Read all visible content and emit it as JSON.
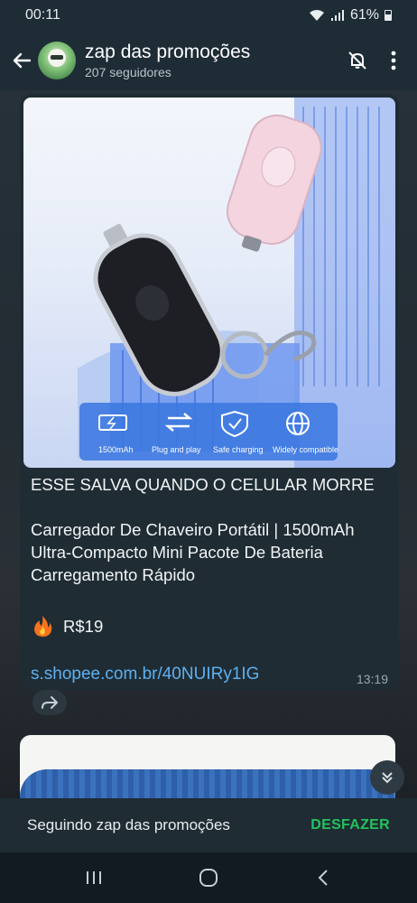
{
  "status_bar": {
    "time": "00:11",
    "battery": "61%"
  },
  "header": {
    "channel_name": "zap das promoções",
    "followers": "207 seguidores"
  },
  "message": {
    "headline": "ESSE SALVA QUANDO O CELULAR MORRE",
    "description": "Carregador De Chaveiro Portátil | 1500mAh Ultra-Compacto Mini Pacote De Bateria Carregamento Rápido",
    "price": "R$19",
    "link": "s.shopee.com.br/40NUIRy1IG",
    "time": "13:19",
    "image_features": [
      {
        "label": "1500mAh",
        "icon": "battery-icon"
      },
      {
        "label": "Plug and play",
        "icon": "swap-arrows-icon"
      },
      {
        "label": "Safe charging",
        "icon": "shield-check-icon"
      },
      {
        "label": "Widely compatible",
        "icon": "globe-icon"
      }
    ]
  },
  "follow_bar": {
    "text": "Seguindo zap das promoções",
    "undo_label": "DESFAZER"
  },
  "colors": {
    "accent_green": "#24c25c",
    "link_blue": "#5fb0f0",
    "header_bg": "#1e2c36"
  }
}
